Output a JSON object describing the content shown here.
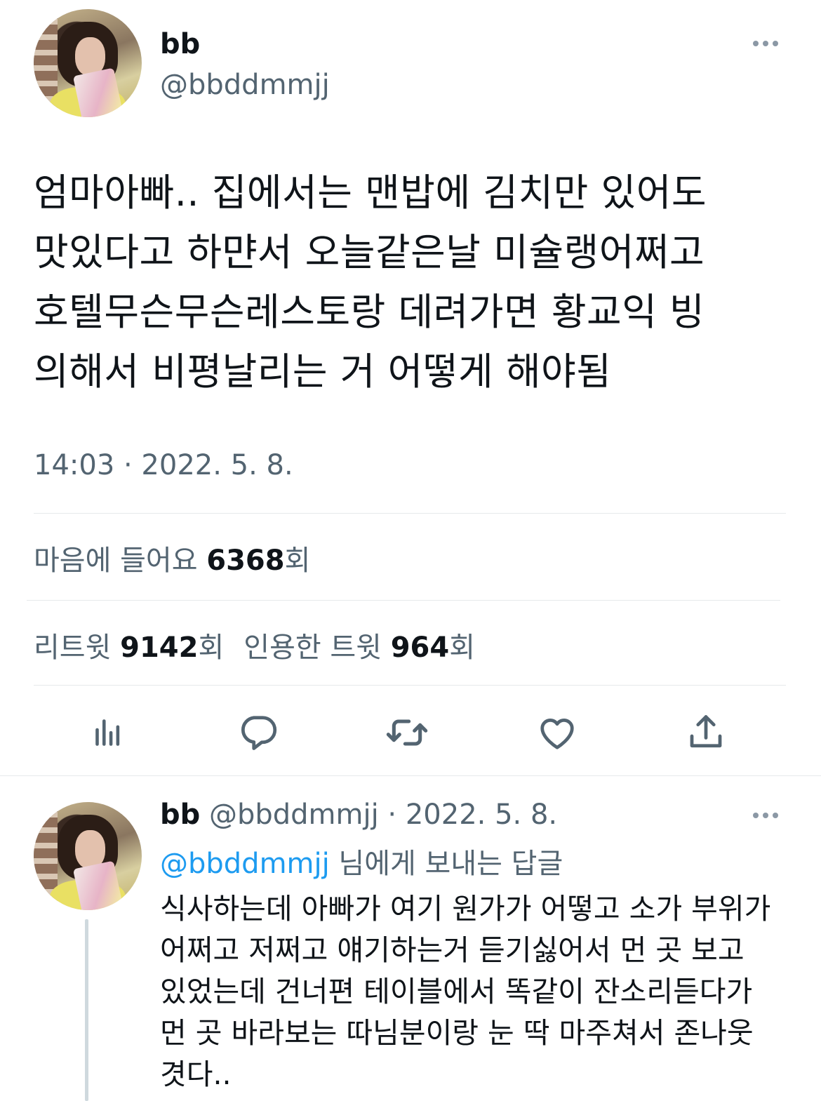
{
  "main_tweet": {
    "display_name": "bb",
    "handle": "@bbddmmjj",
    "text_lines": [
      "엄마아빠.. 집에서는 맨밥에 김치만 있어도",
      "맛있다고 하먄서 오늘같은날 미슐랭어쩌고",
      "호텔무슨무슨레스토랑 데려가면 황교익 빙",
      "의해서 비평날리는 거 어떻게 해야됨"
    ],
    "timestamp": "14:03 · 2022. 5. 8.",
    "likes_label": "마음에 들어요 ",
    "likes_count": "6368",
    "likes_suffix": "회",
    "retweets_label": "리트윗 ",
    "retweets_count": "9142",
    "retweets_suffix": "회",
    "quotes_label": "인용한 트윗 ",
    "quotes_count": "964",
    "quotes_suffix": "회",
    "actions": [
      "stats-icon",
      "reply-icon",
      "retweet-icon",
      "like-icon",
      "share-icon"
    ]
  },
  "reply_tweet": {
    "display_name": "bb",
    "handle": "@bbddmmjj",
    "date": " · 2022. 5. 8.",
    "replying_to_mention": "@bbddmmjj",
    "replying_to_suffix": " 님에게 보내는 답글",
    "text_lines": [
      "식사하는데 아빠가 여기 원가가 어떻고 소가 부위가",
      "어쩌고 저쩌고 얘기하는거 듣기싫어서 먼 곳 보고",
      "있었는데 건너편 테이블에서 똑같이 잔소리듣다가",
      "먼 곳 바라보는 따님분이랑 눈 딱 마주쳐서 존나웃",
      "겻다.."
    ]
  },
  "colors": {
    "text_primary": "#0f1419",
    "text_secondary": "#536471",
    "link": "#1d9bf0",
    "icon": "#536471",
    "divider": "#e6e9eb"
  }
}
